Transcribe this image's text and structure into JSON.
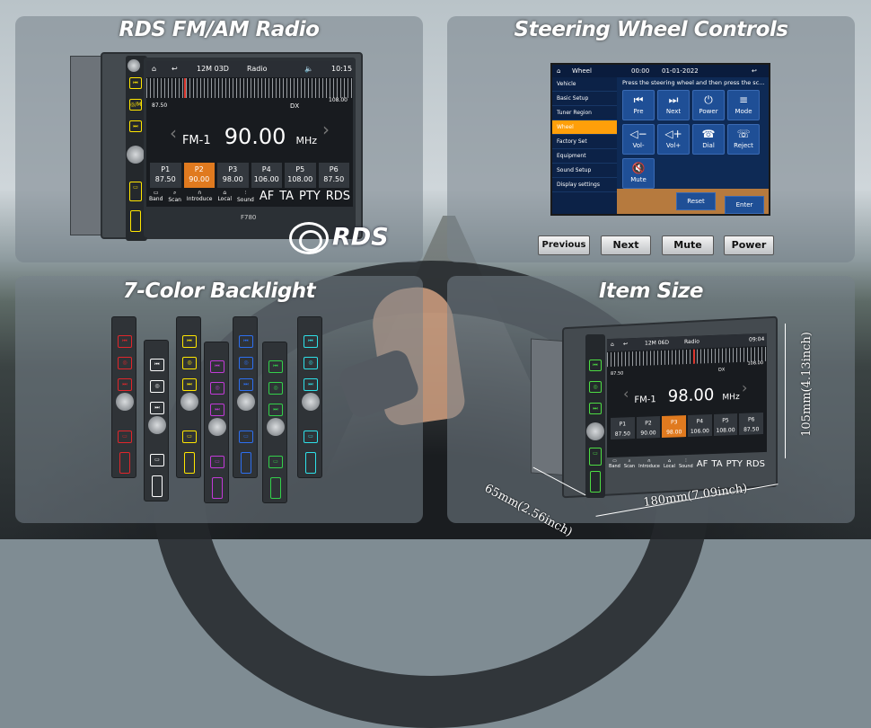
{
  "panels": {
    "rds": {
      "title": "RDS FM/AM Radio"
    },
    "steering": {
      "title": "Steering Wheel Controls"
    },
    "backlight": {
      "title": "7-Color Backlight"
    },
    "size": {
      "title": "Item Size"
    }
  },
  "rds_logo": "RDS",
  "radio_main": {
    "clock": "12M 03D",
    "source": "Radio",
    "time": "10:15",
    "freq_low": "87.50",
    "freq_high": "108.00",
    "flags": "DX",
    "band": "FM-1",
    "frequency": "90.00",
    "unit": "MHz",
    "presets": [
      {
        "label": "P1",
        "freq": "87.50"
      },
      {
        "label": "P2",
        "freq": "90.00"
      },
      {
        "label": "P3",
        "freq": "98.00"
      },
      {
        "label": "P4",
        "freq": "106.00"
      },
      {
        "label": "P5",
        "freq": "108.00"
      },
      {
        "label": "P6",
        "freq": "87.50"
      }
    ],
    "selected_preset": "P2",
    "bottom": [
      "Band",
      "Scan",
      "Introduce",
      "Local",
      "Sound"
    ],
    "bottom_text": [
      "AF",
      "TA",
      "PTY",
      "RDS"
    ],
    "model": "F780"
  },
  "steering_screen": {
    "title": "Wheel",
    "counter": "00:00",
    "date": "01-01-2022",
    "prompt": "Press the steering wheel and then press the sc...",
    "menu": [
      "Vehicle",
      "Basic Setup",
      "Tuner Region",
      "Wheel",
      "Factory Set",
      "Equipment",
      "Sound Setup",
      "Display settings"
    ],
    "active_menu": "Wheel",
    "buttons": [
      {
        "label": "Pre",
        "icon": "⏮"
      },
      {
        "label": "Next",
        "icon": "⏭"
      },
      {
        "label": "Power",
        "icon": "⏻"
      },
      {
        "label": "Mode",
        "icon": "≡"
      },
      {
        "label": "Vol-",
        "icon": "◁−"
      },
      {
        "label": "Vol+",
        "icon": "◁+"
      },
      {
        "label": "Dial",
        "icon": "☎"
      },
      {
        "label": "Reject",
        "icon": "☏"
      },
      {
        "label": "Mute",
        "icon": "🔇"
      }
    ],
    "reset": "Reset",
    "enter": "Enter"
  },
  "control_buttons": [
    "Previous",
    "Next",
    "Mute",
    "Power"
  ],
  "backlight_colors": [
    "#e0262b",
    "#ffffff",
    "#ffe600",
    "#c23ad8",
    "#2d6ff0",
    "#33d04a",
    "#2ee0e8"
  ],
  "radio_size": {
    "clock": "12M 06D",
    "source": "Radio",
    "time": "09:04",
    "freq_low": "87.50",
    "freq_high": "108.00",
    "flags": "DX",
    "band": "FM-1",
    "frequency": "98.00",
    "unit": "MHz",
    "presets": [
      {
        "label": "P1",
        "freq": "87.50"
      },
      {
        "label": "P2",
        "freq": "90.00"
      },
      {
        "label": "P3",
        "freq": "98.00"
      },
      {
        "label": "P4",
        "freq": "106.00"
      },
      {
        "label": "P5",
        "freq": "108.00"
      },
      {
        "label": "P6",
        "freq": "87.50"
      }
    ],
    "selected_preset": "P3",
    "bottom": [
      "Band",
      "Scan",
      "Introduce",
      "Local",
      "Sound"
    ],
    "bottom_text": [
      "AF",
      "TA",
      "PTY",
      "RDS"
    ]
  },
  "dimensions": {
    "depth": "65mm(2.56inch)",
    "width": "180mm(7.09inch)",
    "height": "105mm(4.13inch)"
  }
}
